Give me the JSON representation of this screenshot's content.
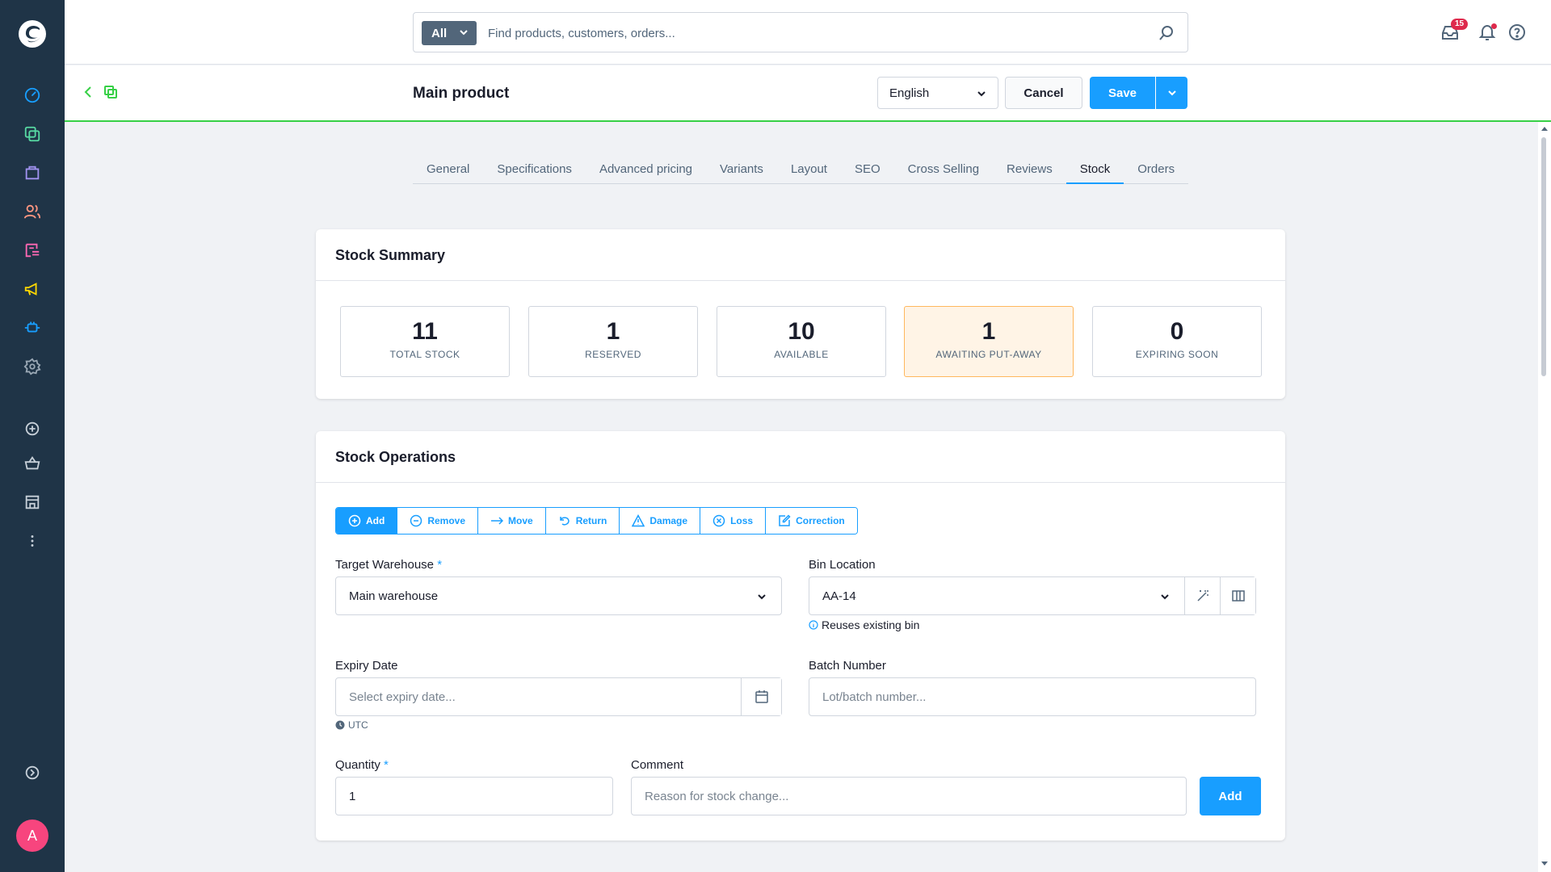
{
  "sidebar": {
    "nav": [
      {
        "name": "dashboard-icon",
        "color": "#189eff"
      },
      {
        "name": "catalog-icon",
        "color": "#57d9a3"
      },
      {
        "name": "orders-icon",
        "color": "#a092f0"
      },
      {
        "name": "customers-icon",
        "color": "#ff9680"
      },
      {
        "name": "content-icon",
        "color": "#ff68b4"
      },
      {
        "name": "marketing-icon",
        "color": "#ffd700"
      },
      {
        "name": "extensions-icon",
        "color": "#189eff"
      },
      {
        "name": "settings-icon",
        "color": "#9aa8b5"
      }
    ],
    "avatar_initial": "A"
  },
  "topbar": {
    "search_type": "All",
    "search_placeholder": "Find products, customers, orders...",
    "notification_count": "15"
  },
  "smartbar": {
    "title": "Main product",
    "language": "English",
    "cancel_label": "Cancel",
    "save_label": "Save"
  },
  "tabs": [
    {
      "label": "General"
    },
    {
      "label": "Specifications"
    },
    {
      "label": "Advanced pricing"
    },
    {
      "label": "Variants"
    },
    {
      "label": "Layout"
    },
    {
      "label": "SEO"
    },
    {
      "label": "Cross Selling"
    },
    {
      "label": "Reviews"
    },
    {
      "label": "Stock",
      "active": true
    },
    {
      "label": "Orders"
    }
  ],
  "stock_summary": {
    "title": "Stock Summary",
    "stats": [
      {
        "value": "11",
        "label": "TOTAL STOCK"
      },
      {
        "value": "1",
        "label": "RESERVED"
      },
      {
        "value": "10",
        "label": "AVAILABLE"
      },
      {
        "value": "1",
        "label": "AWAITING PUT-AWAY",
        "highlight": true
      },
      {
        "value": "0",
        "label": "EXPIRING SOON"
      }
    ]
  },
  "stock_operations": {
    "title": "Stock Operations",
    "operations": [
      {
        "label": "Add",
        "icon": "plus-circle-icon",
        "active": true
      },
      {
        "label": "Remove",
        "icon": "minus-circle-icon"
      },
      {
        "label": "Move",
        "icon": "arrow-right-icon"
      },
      {
        "label": "Return",
        "icon": "undo-icon"
      },
      {
        "label": "Damage",
        "icon": "warning-icon"
      },
      {
        "label": "Loss",
        "icon": "x-circle-icon"
      },
      {
        "label": "Correction",
        "icon": "edit-icon"
      }
    ],
    "target_warehouse_label": "Target Warehouse",
    "target_warehouse_value": "Main warehouse",
    "bin_location_label": "Bin Location",
    "bin_location_value": "AA-14",
    "bin_hint": "Reuses existing bin",
    "expiry_label": "Expiry Date",
    "expiry_placeholder": "Select expiry date...",
    "timezone": "UTC",
    "batch_label": "Batch Number",
    "batch_placeholder": "Lot/batch number...",
    "quantity_label": "Quantity",
    "quantity_value": "1",
    "comment_label": "Comment",
    "comment_placeholder": "Reason for stock change...",
    "submit_label": "Add"
  }
}
